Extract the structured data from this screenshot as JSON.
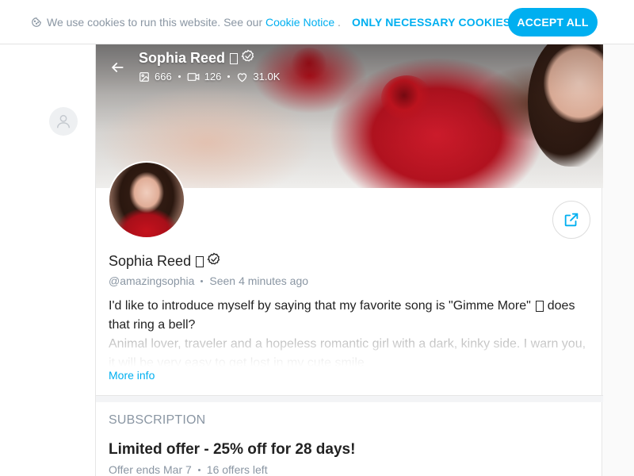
{
  "cookie_banner": {
    "text": "We use cookies to run this website. See our ",
    "link": "Cookie Notice",
    "suffix": " .",
    "necessary_label": "ONLY NECESSARY COOKIES",
    "accept_label": "ACCEPT ALL"
  },
  "profile": {
    "name": "Sophia Reed",
    "name_glyph": "",
    "stats": {
      "photos": "666",
      "videos": "126",
      "likes": "31.0K"
    },
    "username": "@amazingsophia",
    "seen_label": "Seen",
    "seen_value": "4 minutes ago",
    "bio_line1": "I'd like to introduce myself by saying that my favorite song is \"Gimme More\"",
    "bio_line1_end": " does that ring a bell?",
    "bio_faded": "Animal lover, traveler and a hopeless romantic girl with a dark, kinky side. I warn you, it will be very easy to get lost in my cute smile",
    "more_info": "More info"
  },
  "subscription": {
    "section_title": "SUBSCRIPTION",
    "offer_title": "Limited offer - 25% off for 28 days!",
    "offer_ends": "Offer ends Mar 7",
    "offers_left": "16 offers left"
  },
  "colors": {
    "accent": "#00aff0",
    "muted": "#8a96a3",
    "text": "#222222"
  }
}
